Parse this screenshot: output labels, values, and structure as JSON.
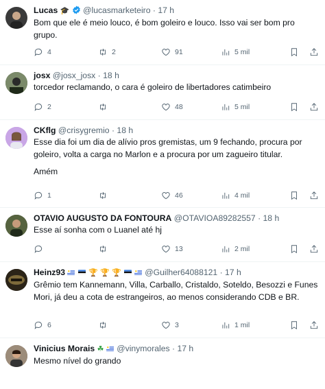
{
  "tweets": [
    {
      "name": "Lucas",
      "handle": "@lucasmarketeiro",
      "time": "17 h",
      "text": [
        "Bom que ele é meio louco, é bom goleiro e louco. Isso vai ser bom pro grupo."
      ],
      "replies": "4",
      "retweets": "2",
      "likes": "91",
      "views": "5 mil",
      "avatar_color": "#3a3a3a"
    },
    {
      "name": "josx",
      "handle": "@josx_josx",
      "time": "18 h",
      "text": [
        "torcedor reclamando, o cara é goleiro de libertadores catimbeiro"
      ],
      "replies": "2",
      "retweets": "",
      "likes": "48",
      "views": "5 mil",
      "avatar_color": "#4a5a3a"
    },
    {
      "name": "CKflg",
      "handle": "@crisygremio",
      "time": "18 h",
      "text": [
        "Esse dia foi um dia de alívio pros gremistas, um 9 fechando, procura por goleiro, volta a carga no Marlon e a procura por um zagueiro titular.",
        "Amém"
      ],
      "replies": "1",
      "retweets": "",
      "likes": "46",
      "views": "4 mil",
      "avatar_color": "#b48ad6"
    },
    {
      "name": "OTAVIO AUGUSTO DA FONTOURA",
      "handle": "@OTAVIOA89282557",
      "time": "18 h",
      "text": [
        "Esse aí sonha com o Luanel até hj"
      ],
      "replies": "",
      "retweets": "",
      "likes": "13",
      "views": "2 mil",
      "avatar_color": "#2f3b2a"
    },
    {
      "name": "Heinz93",
      "handle": "@Guilher64088121",
      "time": "17 h",
      "text": [
        "Grêmio tem Kannemann, Villa, Carballo, Cristaldo, Soteldo, Besozzi e Funes Mori, já deu a cota de estrangeiros, ao menos considerando CDB e BR."
      ],
      "replies": "6",
      "retweets": "",
      "likes": "3",
      "views": "1 mil",
      "avatar_color": "#1e1e1e"
    },
    {
      "name": "Vinicius Morais",
      "handle": "@vinymorales",
      "time": "17 h",
      "text": [
        "Mesmo nível do grando"
      ],
      "replies": "",
      "retweets": "",
      "likes": "",
      "views": "",
      "avatar_color": "#6a5a4a"
    }
  ],
  "separator": "·",
  "colors": {
    "text": "#0f1419",
    "muted": "#536471",
    "verified": "#1d9bf0",
    "border": "#eff3f4"
  }
}
